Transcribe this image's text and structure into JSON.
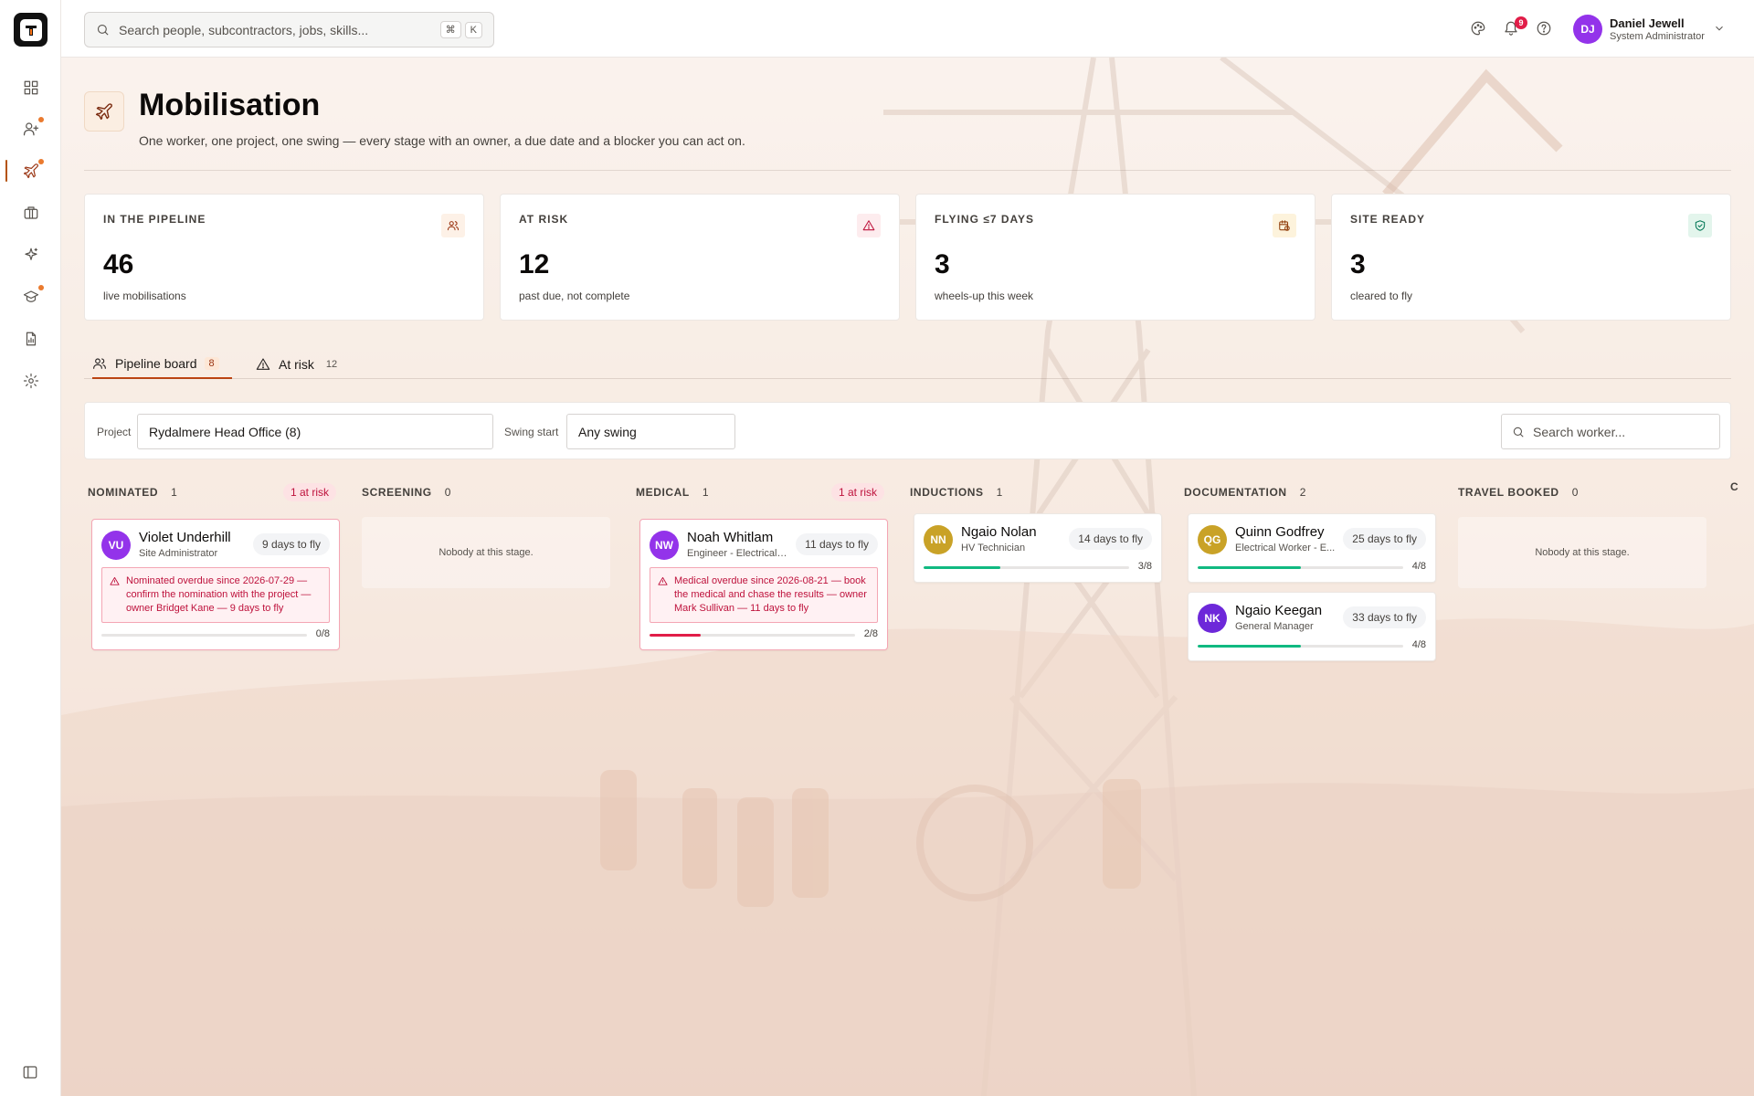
{
  "search": {
    "placeholder": "Search people, subcontractors, jobs, skills...",
    "kbd_cmd": "⌘",
    "kbd_key": "K"
  },
  "notifications": {
    "count": "9"
  },
  "user": {
    "initials": "DJ",
    "name": "Daniel Jewell",
    "role": "System Administrator",
    "avatar_color": "#9333ea"
  },
  "sidebar": {
    "items": [
      {
        "icon": "dashboard-icon",
        "dot": false
      },
      {
        "icon": "user-plus-icon",
        "dot": true
      },
      {
        "icon": "plane-icon",
        "dot": true,
        "active": true
      },
      {
        "icon": "briefcase-icon",
        "dot": false
      },
      {
        "icon": "sparkles-icon",
        "dot": false
      },
      {
        "icon": "graduation-cap-icon",
        "dot": true
      },
      {
        "icon": "report-icon",
        "dot": false
      },
      {
        "icon": "gear-icon",
        "dot": false
      }
    ]
  },
  "page": {
    "title": "Mobilisation",
    "subtitle": "One worker, one project, one swing — every stage with an owner, a due date and a blocker you can act on."
  },
  "stats": [
    {
      "label": "IN THE PIPELINE",
      "value": "46",
      "note": "live mobilisations",
      "icon": "users-icon",
      "icon_color": "#9a3412",
      "icon_bg": "#fdf1e7"
    },
    {
      "label": "AT RISK",
      "value": "12",
      "note": "past due, not complete",
      "icon": "warning-icon",
      "icon_color": "#be123c",
      "icon_bg": "#fdecee"
    },
    {
      "label": "FLYING ≤7 DAYS",
      "value": "3",
      "note": "wheels-up this week",
      "icon": "calendar-clock-icon",
      "icon_color": "#92400e",
      "icon_bg": "#fdf3dc"
    },
    {
      "label": "SITE READY",
      "value": "3",
      "note": "cleared to fly",
      "icon": "shield-check-icon",
      "icon_color": "#047857",
      "icon_bg": "#e3f5ec"
    }
  ],
  "tabs": [
    {
      "label": "Pipeline board",
      "count": "8",
      "active": true
    },
    {
      "label": "At risk",
      "count": "12",
      "active": false
    }
  ],
  "filters": {
    "project_label": "Project",
    "project_value": "Rydalmere Head Office (8)",
    "swing_label": "Swing start",
    "swing_value": "Any swing",
    "worker_search_placeholder": "Search worker..."
  },
  "columns": [
    {
      "title": "NOMINATED",
      "count": "1",
      "risk": "1 at risk"
    },
    {
      "title": "SCREENING",
      "count": "0",
      "empty": "Nobody at this stage."
    },
    {
      "title": "MEDICAL",
      "count": "1",
      "risk": "1 at risk"
    },
    {
      "title": "INDUCTIONS",
      "count": "1"
    },
    {
      "title": "DOCUMENTATION",
      "count": "2"
    },
    {
      "title": "TRAVEL BOOKED",
      "count": "0",
      "empty": "Nobody at this stage."
    }
  ],
  "edge_column_title": "C",
  "cards": [
    {
      "initials": "VU",
      "name": "Violet Underhill",
      "role": "Site Administrator",
      "fly": "9 days to fly",
      "avatar_color": "#9333ea",
      "alert": "Nominated overdue since 2026-07-29 — confirm the nomination with the project — owner Bridget Kane — 9 days to fly",
      "progress": 0,
      "progress_text": "0/8",
      "bar_color": "#e11d48"
    },
    {
      "initials": "NW",
      "name": "Noah Whitlam",
      "role": "Engineer - Electrical I...",
      "fly": "11 days to fly",
      "avatar_color": "#9333ea",
      "alert": "Medical overdue since 2026-08-21 — book the medical and chase the results — owner Mark Sullivan — 11 days to fly",
      "progress": 0.25,
      "progress_text": "2/8",
      "bar_color": "#e11d48"
    },
    {
      "initials": "NN",
      "name": "Ngaio Nolan",
      "role": "HV Technician",
      "fly": "14 days to fly",
      "avatar_color": "#c9a227",
      "progress": 0.375,
      "progress_text": "3/8",
      "bar_color": "#10b981"
    },
    {
      "initials": "QG",
      "name": "Quinn Godfrey",
      "role": "Electrical Worker - E...",
      "fly": "25 days to fly",
      "avatar_color": "#c9a227",
      "progress": 0.5,
      "progress_text": "4/8",
      "bar_color": "#10b981"
    },
    {
      "initials": "NK",
      "name": "Ngaio Keegan",
      "role": "General Manager",
      "fly": "33 days to fly",
      "avatar_color": "#6d28d9",
      "progress": 0.5,
      "progress_text": "4/8",
      "bar_color": "#10b981"
    }
  ]
}
